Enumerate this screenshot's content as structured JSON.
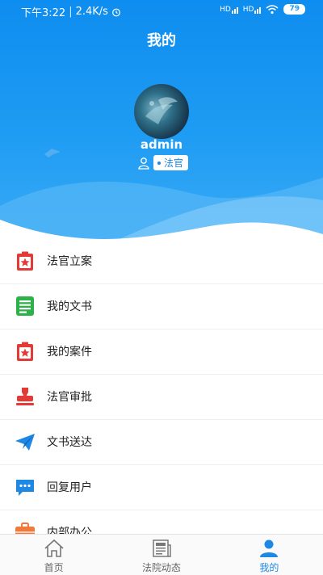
{
  "status_bar": {
    "time": "下午3:22",
    "speed": "2.4K/s",
    "battery": "79",
    "net1": "HD",
    "net2": "HD"
  },
  "header": {
    "title": "我的"
  },
  "profile": {
    "username": "admin",
    "role": "法官"
  },
  "menu": [
    {
      "label": "法官立案",
      "icon": "clipboard-star-icon",
      "color": "#e53935"
    },
    {
      "label": "我的文书",
      "icon": "document-lines-icon",
      "color": "#2db24a"
    },
    {
      "label": "我的案件",
      "icon": "clipboard-star-icon",
      "color": "#e53935"
    },
    {
      "label": "法官审批",
      "icon": "stamp-icon",
      "color": "#e53935"
    },
    {
      "label": "文书送达",
      "icon": "paper-plane-icon",
      "color": "#1e88e5"
    },
    {
      "label": "回复用户",
      "icon": "chat-bubble-icon",
      "color": "#1e88e5"
    },
    {
      "label": "内部办公",
      "icon": "briefcase-icon",
      "color": "#f07a3a"
    }
  ],
  "tabs": [
    {
      "label": "首页",
      "icon": "home-icon"
    },
    {
      "label": "法院动态",
      "icon": "newspaper-icon"
    },
    {
      "label": "我的",
      "icon": "user-icon",
      "active": true
    }
  ],
  "colors": {
    "accent": "#1e88e5",
    "hero": "#1e9cf3"
  }
}
